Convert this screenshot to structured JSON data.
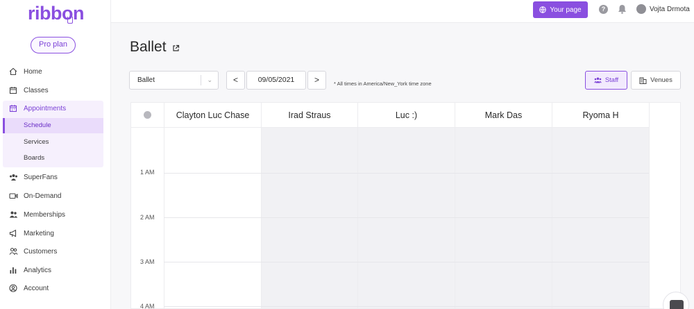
{
  "brand": {
    "logo_text": "ribbon",
    "plan_button": "Pro plan",
    "accent_color": "#8a4fe0"
  },
  "sidebar": {
    "items": [
      {
        "label": "Home",
        "icon": "home-icon"
      },
      {
        "label": "Classes",
        "icon": "calendar-icon"
      },
      {
        "label": "Appointments",
        "icon": "calendar-grid-icon",
        "active": true
      },
      {
        "label": "SuperFans",
        "icon": "users-group-icon"
      },
      {
        "label": "On-Demand",
        "icon": "video-icon"
      },
      {
        "label": "Memberships",
        "icon": "members-icon"
      },
      {
        "label": "Marketing",
        "icon": "megaphone-icon"
      },
      {
        "label": "Customers",
        "icon": "customers-icon"
      },
      {
        "label": "Analytics",
        "icon": "bar-chart-icon"
      },
      {
        "label": "Account",
        "icon": "account-circle-icon"
      }
    ],
    "appointments_sub": [
      {
        "label": "Schedule",
        "active": true
      },
      {
        "label": "Services"
      },
      {
        "label": "Boards"
      }
    ]
  },
  "topbar": {
    "your_page": "Your page",
    "help": "?",
    "user_name": "Vojta Drmota"
  },
  "page": {
    "title": "Ballet"
  },
  "toolbar": {
    "class_select": "Ballet",
    "prev": "<",
    "date": "09/05/2021",
    "next": ">",
    "timezone_note": "* All times in America/New_York time zone",
    "staff_button": "Staff",
    "venues_button": "Venues"
  },
  "calendar": {
    "staff": [
      "Clayton Luc Chase",
      "Irad Straus",
      "Luc :)",
      "Mark Das",
      "Ryoma H"
    ],
    "hours": [
      "1 AM",
      "2 AM",
      "3 AM",
      "4 AM"
    ]
  }
}
